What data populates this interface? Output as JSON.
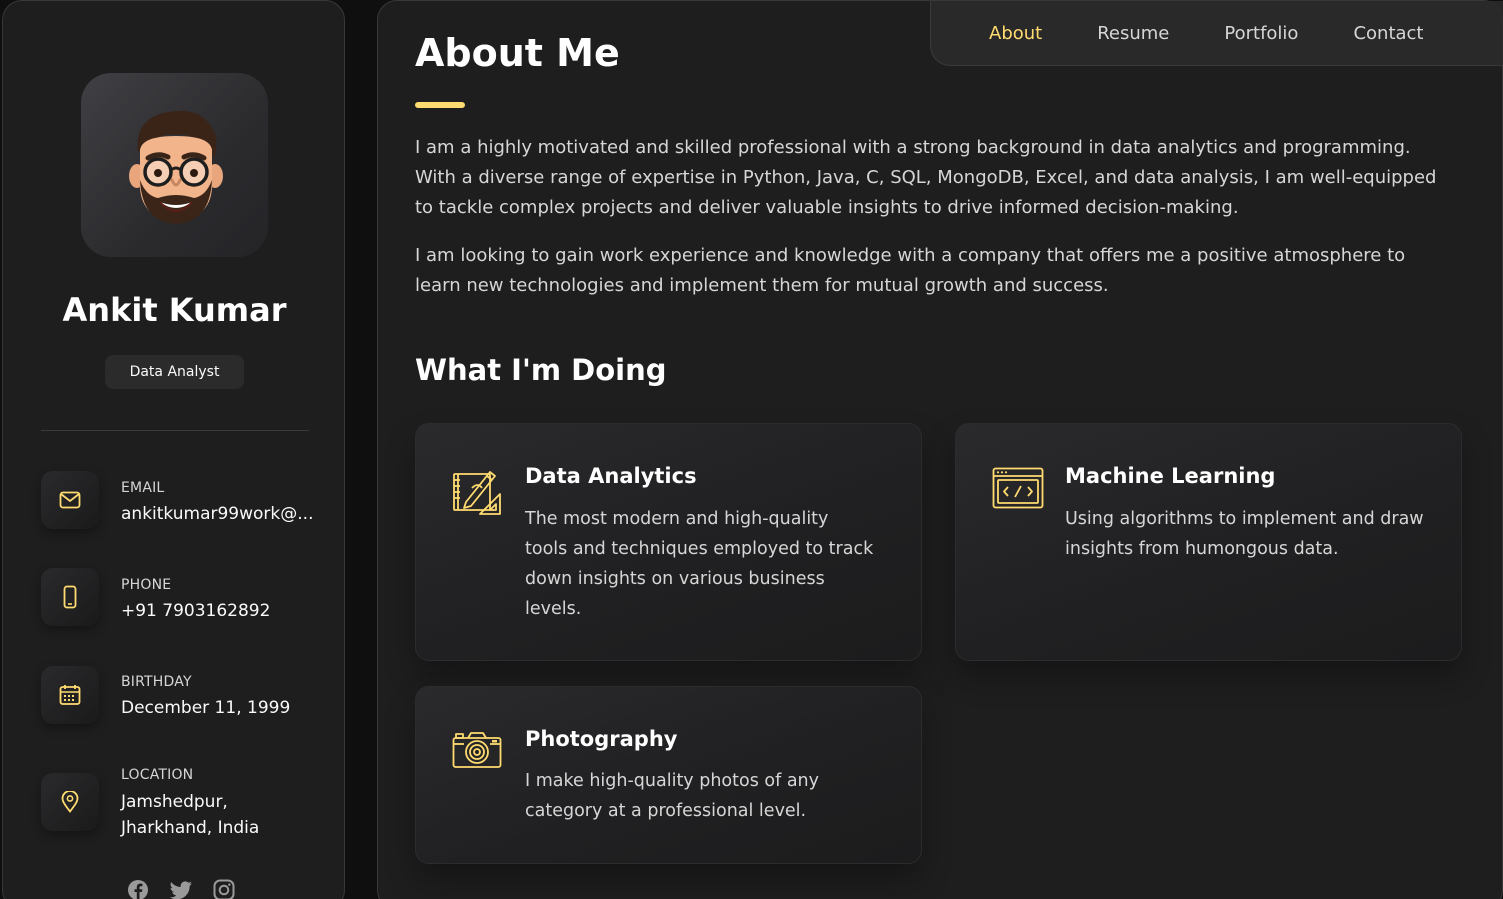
{
  "profile": {
    "name": "Ankit Kumar",
    "title": "Data Analyst"
  },
  "contacts": [
    {
      "label": "EMAIL",
      "value": "ankitkumar99work@...",
      "icon": "mail-icon"
    },
    {
      "label": "PHONE",
      "value": "+91 7903162892",
      "icon": "phone-icon"
    },
    {
      "label": "BIRTHDAY",
      "value": "December 11, 1999",
      "icon": "calendar-icon"
    },
    {
      "label": "LOCATION",
      "value": "Jamshedpur, Jharkhand, India",
      "icon": "location-pin-icon"
    }
  ],
  "socials": [
    "facebook-icon",
    "twitter-icon",
    "instagram-icon"
  ],
  "nav": {
    "items": [
      "About",
      "Resume",
      "Portfolio",
      "Contact"
    ],
    "active": "About"
  },
  "about": {
    "heading": "About Me",
    "paragraphs": [
      "I am a highly motivated and skilled professional with a strong background in data analytics and programming. With a diverse range of expertise in Python, Java, C, SQL, MongoDB, Excel, and data analysis, I am well-equipped to tackle complex projects and deliver valuable insights to drive informed decision-making.",
      "I am looking to gain work experience and knowledge with a company that offers me a positive atmosphere to learn new technologies and implement them for mutual growth and success."
    ]
  },
  "services": {
    "heading": "What I'm Doing",
    "items": [
      {
        "title": "Data Analytics",
        "text": "The most modern and high-quality tools and techniques employed to track down insights on various business levels.",
        "icon": "design-tools-icon"
      },
      {
        "title": "Machine Learning",
        "text": "Using algorithms to implement and draw insights from humongous data.",
        "icon": "code-window-icon"
      },
      {
        "title": "Photography",
        "text": "I make high-quality photos of any category at a professional level.",
        "icon": "camera-icon"
      }
    ]
  },
  "colors": {
    "accent": "#ffdb70",
    "panel": "#1e1e1f",
    "background": "#0f0f10"
  }
}
